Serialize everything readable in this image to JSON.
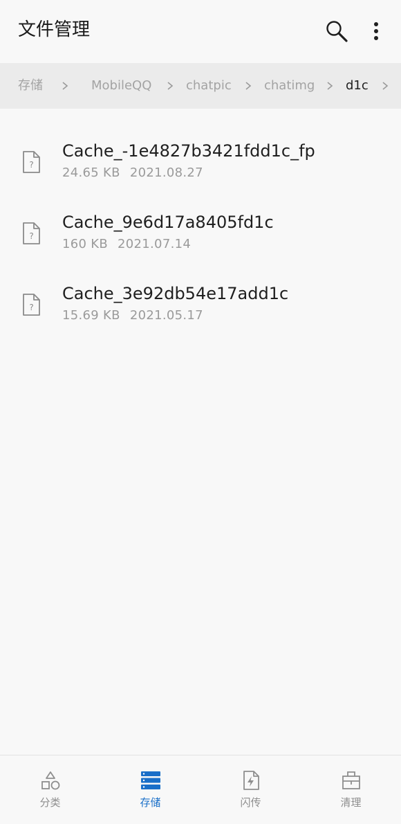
{
  "app_bar": {
    "title": "文件管理",
    "search_icon": "search-icon",
    "more_icon": "more-vert-icon"
  },
  "breadcrumb": {
    "items": [
      {
        "label": "存储"
      },
      {
        "label": "MobileQQ"
      },
      {
        "label": "chatpic"
      },
      {
        "label": "chatimg"
      },
      {
        "label": "d1c"
      }
    ],
    "separator_icon": "chevron-right-icon"
  },
  "files": [
    {
      "name": "Cache_-1e4827b3421fdd1c_fp",
      "size": "24.65 KB",
      "date": "2021.08.27",
      "icon": "unknown-file-icon"
    },
    {
      "name": "Cache_9e6d17a8405fd1c",
      "size": "160 KB",
      "date": "2021.07.14",
      "icon": "unknown-file-icon"
    },
    {
      "name": "Cache_3e92db54e17add1c",
      "size": "15.69 KB",
      "date": "2021.05.17",
      "icon": "unknown-file-icon"
    }
  ],
  "bottom_nav": {
    "items": [
      {
        "label": "分类",
        "icon": "category-icon",
        "active": false
      },
      {
        "label": "存储",
        "icon": "storage-icon",
        "active": true
      },
      {
        "label": "闪传",
        "icon": "flash-transfer-icon",
        "active": false
      },
      {
        "label": "清理",
        "icon": "clean-icon",
        "active": false
      }
    ]
  },
  "colors": {
    "accent": "#1a6fc8",
    "background": "#f8f8f8",
    "breadcrumb_bg": "#ebebeb",
    "muted_text": "#9a9a9a"
  }
}
